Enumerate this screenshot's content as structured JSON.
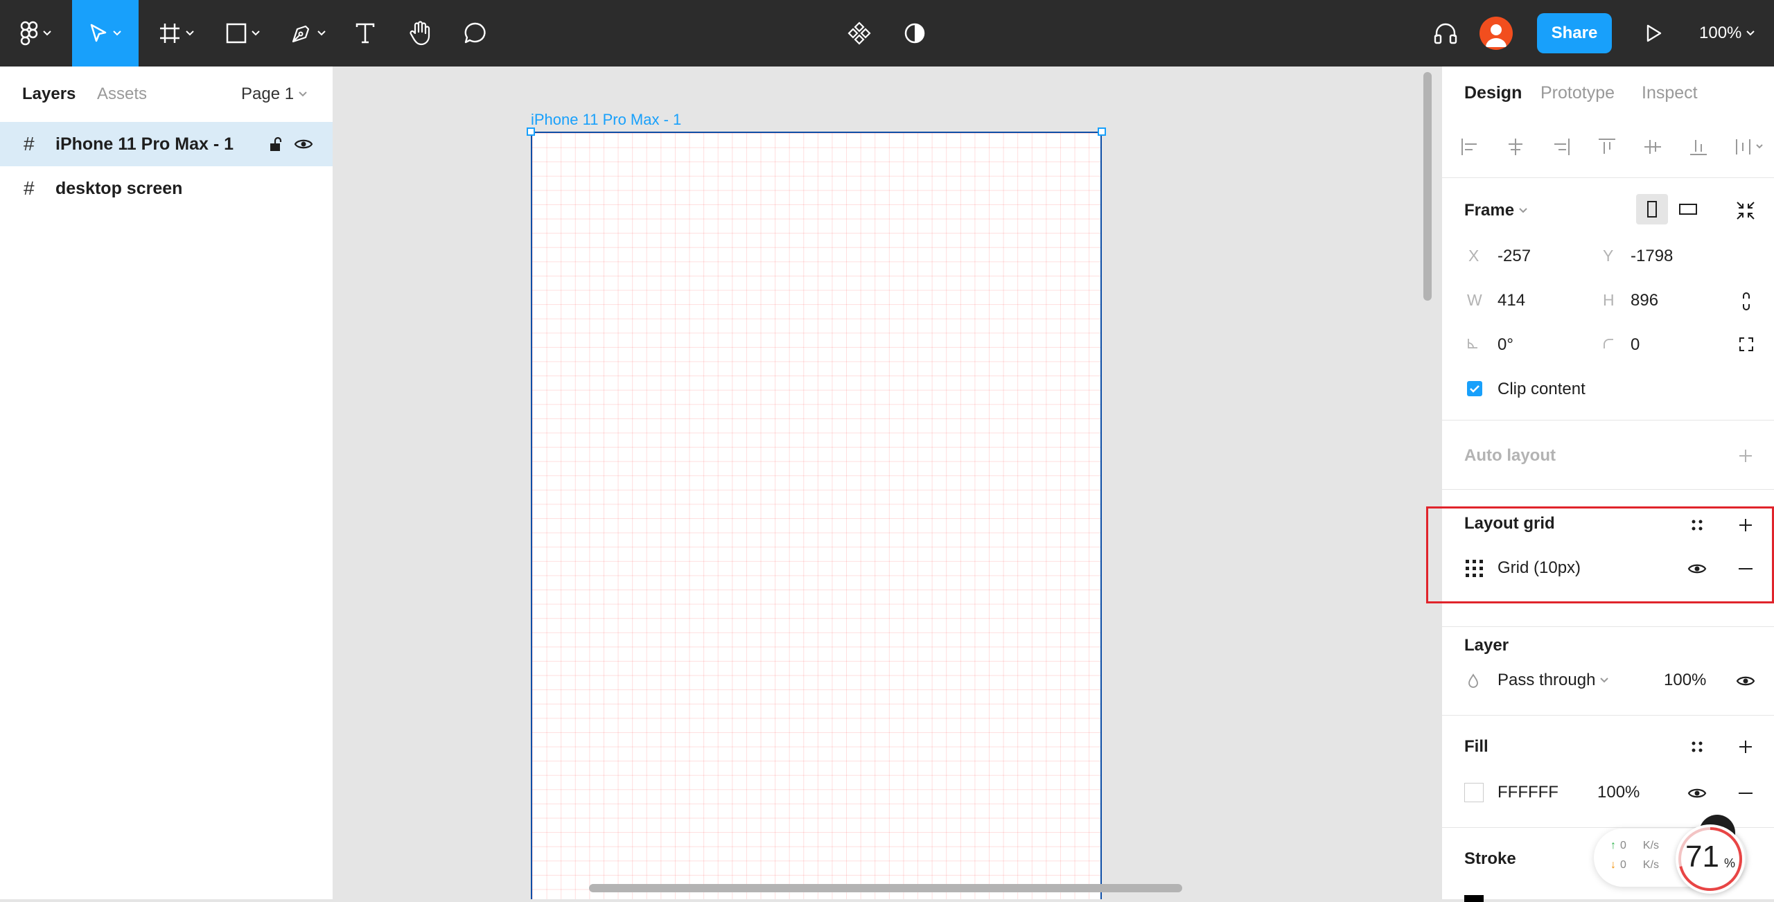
{
  "toolbar": {
    "icons": [
      "figma-menu-icon",
      "move-tool-icon",
      "frame-tool-icon",
      "shape-tool-icon",
      "pen-tool-icon",
      "text-tool-icon",
      "hand-tool-icon",
      "comment-tool-icon",
      "components-icon",
      "theme-toggle-icon",
      "audio-icon",
      "avatar",
      "play-icon"
    ],
    "share_label": "Share",
    "zoom_label": "100%"
  },
  "left_panel": {
    "tabs": {
      "layers": "Layers",
      "assets": "Assets"
    },
    "page_select": "Page 1",
    "layers": [
      {
        "name": "iPhone 11 Pro Max - 1",
        "selected": true
      },
      {
        "name": "desktop screen",
        "selected": false
      }
    ],
    "hash_glyph": "#"
  },
  "canvas": {
    "frame_label": "iPhone 11 Pro Max - 1"
  },
  "right_panel": {
    "tabs": {
      "design": "Design",
      "prototype": "Prototype",
      "inspect": "Inspect"
    },
    "frame": {
      "title": "Frame",
      "x_label": "X",
      "x_value": "-257",
      "y_label": "Y",
      "y_value": "-1798",
      "w_label": "W",
      "w_value": "414",
      "h_label": "H",
      "h_value": "896",
      "rotation_value": "0°",
      "radius_value": "0",
      "clip_label": "Clip content",
      "clip_checked": true
    },
    "auto_layout": {
      "title": "Auto layout"
    },
    "layout_grid": {
      "title": "Layout grid",
      "item": "Grid (10px)"
    },
    "layer": {
      "title": "Layer",
      "blend": "Pass through",
      "opacity": "100%"
    },
    "fill": {
      "title": "Fill",
      "hex": "FFFFFF",
      "opacity": "100%"
    },
    "stroke": {
      "title": "Stroke"
    }
  },
  "network_widget": {
    "up_value": "0",
    "up_unit": "K/s",
    "down_value": "0",
    "down_unit": "K/s",
    "cpu_percent": "71",
    "percent_sign": "%"
  },
  "colors": {
    "accent": "#18a0fb",
    "toolbar_bg": "#2c2c2c",
    "highlight": "#e0242b"
  }
}
